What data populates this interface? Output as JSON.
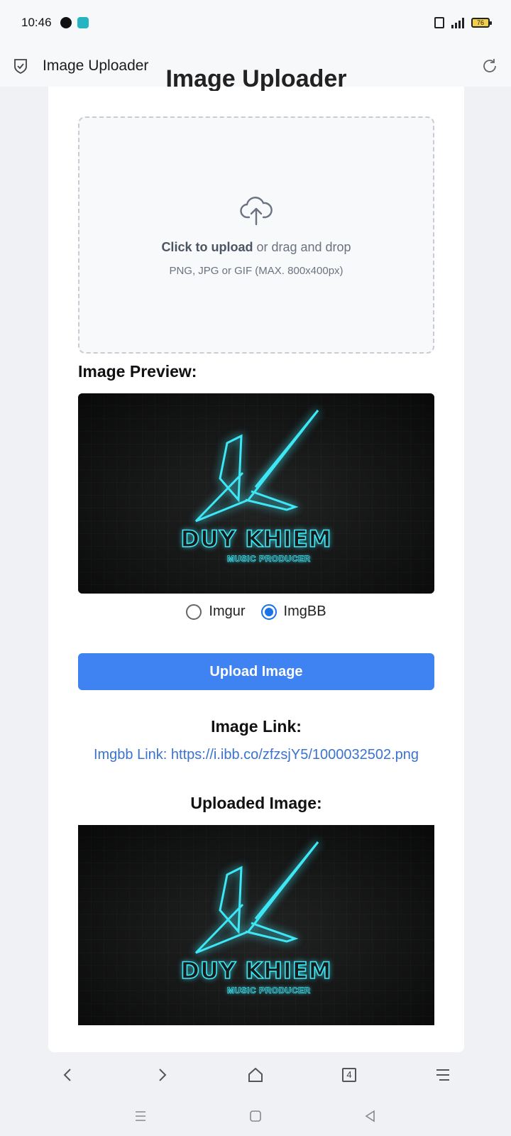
{
  "status_bar": {
    "time": "10:46",
    "battery": "76",
    "icons": [
      "messenger-icon",
      "chat-app-icon",
      "vibrate-icon",
      "signal-icon",
      "battery-icon"
    ]
  },
  "app_bar": {
    "title": "Image Uploader",
    "icons": [
      "shield-icon",
      "refresh-icon"
    ]
  },
  "card": {
    "cut_heading": "Image Uploader",
    "dropzone": {
      "primary_bold": "Click to upload",
      "primary_rest": " or drag and drop",
      "hint": "PNG, JPG or GIF (MAX. 800x400px)"
    },
    "preview_label": "Image Preview:",
    "logo": {
      "name": "DUY KHIEM",
      "sub": "MUSIC PRODUCER"
    },
    "radio_options": [
      {
        "label": "Imgur",
        "checked": false
      },
      {
        "label": "ImgBB",
        "checked": true
      }
    ],
    "upload_button": "Upload Image",
    "link_heading": "Image Link:",
    "link_text": "Imgbb Link: https://i.ibb.co/zfzsjY5/1000032502.png",
    "uploaded_heading": "Uploaded Image:"
  },
  "browser_nav": {
    "tab_count": "4",
    "icons": [
      "back-icon",
      "forward-icon",
      "home-icon",
      "tabs-icon",
      "menu-icon"
    ]
  },
  "system_nav": {
    "icons": [
      "recents-icon",
      "home-square-icon",
      "back-triangle-icon"
    ]
  },
  "colors": {
    "accent": "#3f83f2",
    "link": "#3b73cf",
    "neon": "#3ee7f5"
  }
}
